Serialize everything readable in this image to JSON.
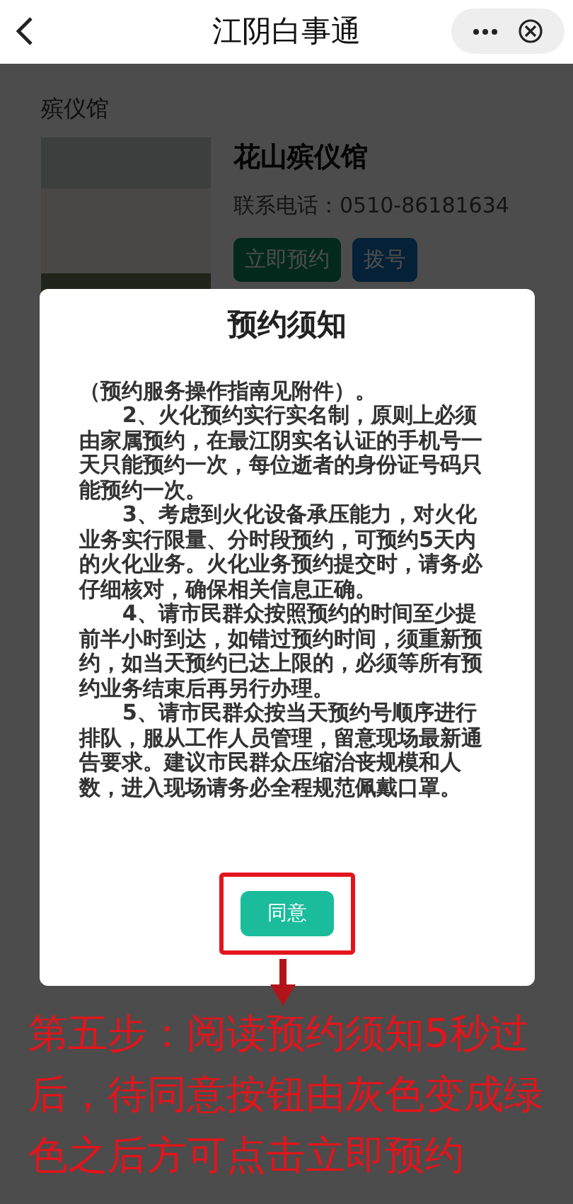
{
  "header": {
    "title": "江阴白事通"
  },
  "section_title": "殡仪馆",
  "venue": {
    "name": "花山殡仪馆",
    "phone": "联系电话：0510-86181634",
    "buttons": [
      {
        "label": "立即预约",
        "kind": "primary"
      },
      {
        "label": "拨号",
        "kind": "secondary"
      }
    ]
  },
  "modal": {
    "title": "预约须知",
    "paragraphs": [
      {
        "kind": "continuation",
        "text": "（预约服务操作指南见附件）。"
      },
      {
        "kind": "item",
        "text": "2、火化预约实行实名制，原则上必须由家属预约，在最江阴实名认证的手机号一天只能预约一次，每位逝者的身份证号码只能预约一次。"
      },
      {
        "kind": "item",
        "text": "3、考虑到火化设备承压能力，对火化业务实行限量、分时段预约，可预约5天内的火化业务。火化业务预约提交时，请务必仔细核对，确保相关信息正确。"
      },
      {
        "kind": "item",
        "text": "4、请市民群众按照预约的时间至少提前半小时到达，如错过预约时间，须重新预约，如当天预约已达上限的，必须等所有预约业务结束后再另行办理。"
      },
      {
        "kind": "item",
        "text": "5、请市民群众按当天预约号顺序进行排队，服从工作人员管理，留意现场最新通告要求。建议市民群众压缩治丧规模和人数，进入现场请务必全程规范佩戴口罩。"
      }
    ],
    "agree_button": {
      "label": "同意",
      "disabled": false
    }
  },
  "annotation": {
    "text": "第五步：阅读预约须知5秒过后，待同意按钮由灰色变成绿色之后方可点击立即预约"
  }
}
